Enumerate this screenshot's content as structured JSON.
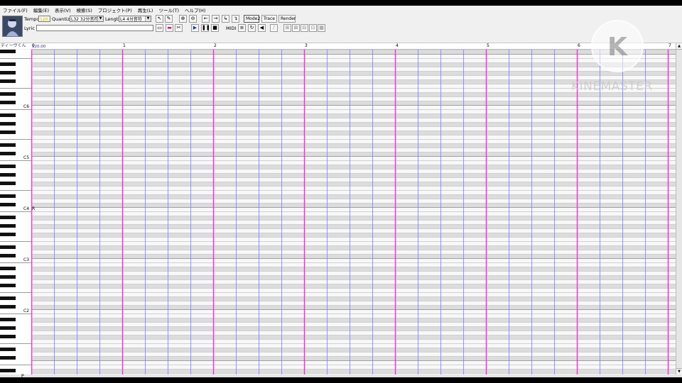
{
  "menu": [
    "ファイル(F)",
    "編集(E)",
    "表示(V)",
    "検索(S)",
    "プロジェクト(P)",
    "再生(L)",
    "ツール(T)",
    "ヘルプ(H)"
  ],
  "toolbar": {
    "tempo_label": "Tempo",
    "tempo_value": "120.0",
    "quantize_label": "Quantize",
    "quantize_value": "L32 32分音符",
    "length_label": "Length",
    "length_value": "L4  4分音符",
    "lyric_label": "Lyric",
    "lyric_value": "",
    "midi_label": "MIDI",
    "mode_label": "Mode2",
    "trace_label": "Trace",
    "render_label": "Render"
  },
  "track": {
    "name": "ディーヴくん"
  },
  "ruler": {
    "start_tempo": "120.00",
    "measures": [
      "0",
      "1",
      "2",
      "3",
      "4",
      "5",
      "6",
      "7"
    ]
  },
  "keyboard": {
    "octaves": [
      "C6",
      "C5",
      "C4",
      "C3",
      "C2"
    ],
    "cursor_note": "R",
    "bottom_label": "P"
  },
  "watermark": {
    "text": "KINEMASTER"
  },
  "icons": {
    "pointer": "pointer-icon",
    "pencil": "pencil-icon",
    "zoom_in": "zoom-in-icon",
    "zoom_out": "zoom-out-icon",
    "back": "arrow-left-icon",
    "forward": "arrow-right-icon",
    "play": "play-icon",
    "pause": "pause-icon",
    "stop": "stop-icon"
  },
  "colors": {
    "measure_line": "#e040c8",
    "beat_line": "#8080f0",
    "black_key_row": "#dcdcdc",
    "white_key_row": "#f8f8f8",
    "track_name": "#2a2aa0",
    "tempo_value": "#c8a000"
  }
}
